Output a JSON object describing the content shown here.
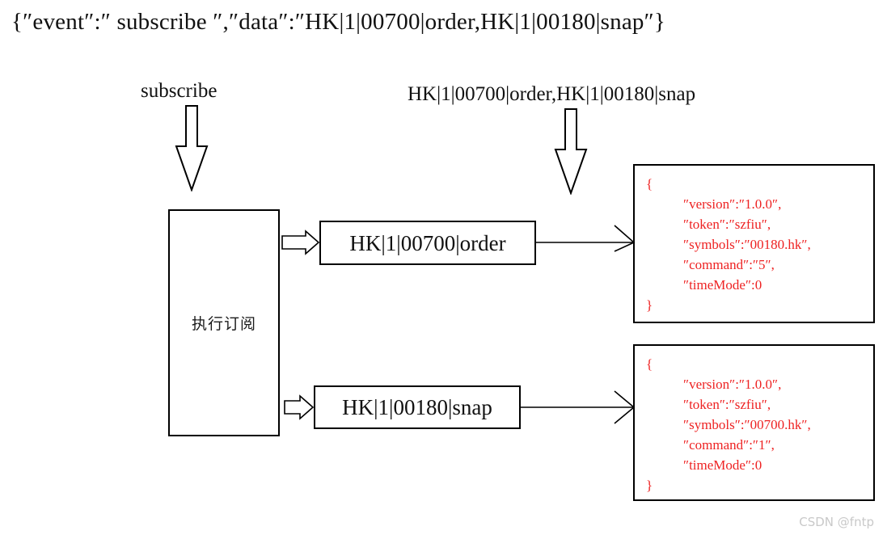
{
  "header": {
    "expression": "{″event″:″ subscribe ″,″data″:″HK|1|00700|order,HK|1|00180|snap″}"
  },
  "callouts": {
    "subscribe_label": "subscribe",
    "data_label": "HK|1|00700|order,HK|1|00180|snap"
  },
  "process": {
    "execute_label": "执行订阅"
  },
  "commands": [
    {
      "label": "HK|1|00700|order"
    },
    {
      "label": "HK|1|00180|snap"
    }
  ],
  "payloads": [
    {
      "open_brace": "{",
      "lines": [
        "″version″:″1.0.0″,",
        "″token″:″szfiu″,",
        "″symbols″:″00180.hk″,",
        "″command″:″5″,",
        "″timeMode″:0"
      ],
      "close_brace": "}"
    },
    {
      "open_brace": "{",
      "lines": [
        "″version″:″1.0.0″,",
        "″token″:″szfiu″,",
        "″symbols″:″00700.hk″,",
        "″command″:″1″,",
        "″timeMode″:0"
      ],
      "close_brace": "}"
    }
  ],
  "watermark": {
    "text": "CSDN @fntp"
  },
  "colors": {
    "stroke": "#000000",
    "json_text": "#ee2222",
    "background": "#ffffff",
    "watermark": "#c9c9c9"
  }
}
